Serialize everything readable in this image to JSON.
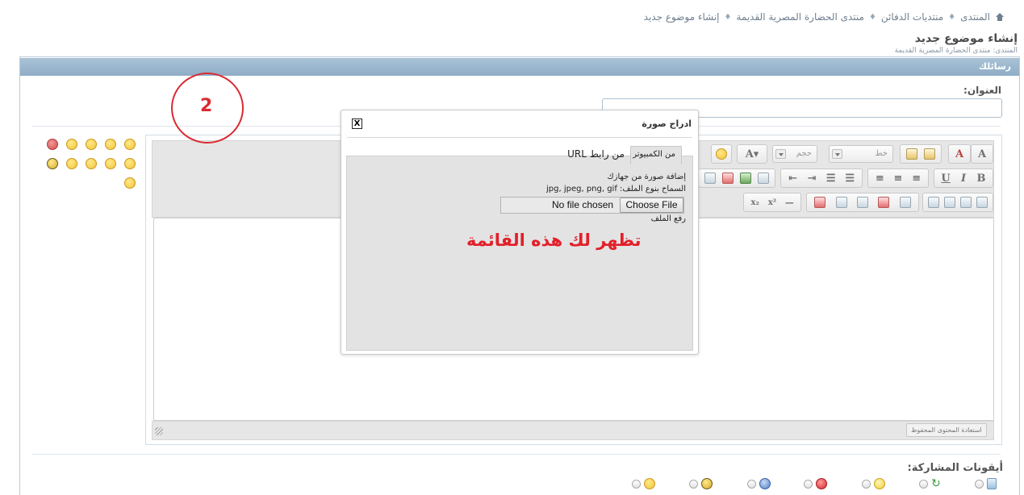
{
  "breadcrumb": {
    "items": [
      "المنتدى",
      "منتديات الدفائن",
      "منتدى الحضارة المصرية القديمة"
    ],
    "current": "إنشاء موضوع جديد",
    "separator": "♦"
  },
  "page": {
    "title": "إنشاء موضوع جديد",
    "subtitle": "المنتدى: منتدى الحضارة المصرية القديمة"
  },
  "section_header": "رسائلك",
  "form": {
    "title_label": "العنوان:",
    "title_value": ""
  },
  "editor": {
    "font_select": "خط",
    "size_select": "حجم",
    "restore_label": "استعادة المحتوى المحفوظ",
    "content": ""
  },
  "dialog": {
    "title": "ادراج صورة",
    "close_label": "X",
    "tabs": [
      "من الكمبيوتر",
      "من رابط URL"
    ],
    "active_tab": "من الكمبيوتر",
    "upload_heading": "إضافة صورة من جهازك",
    "allowed_types": "السماح بنوع الملف: jpg, jpeg, png, gif",
    "choose_button": "Choose File",
    "no_file": "No file chosen",
    "upload_label": "رفع الملف"
  },
  "annotation": {
    "text": "تظهر لك هذه القائمة",
    "number": "2",
    "color": "#e2202a"
  },
  "post_icons": {
    "label": "أيقونات المشاركة:"
  },
  "colors": {
    "header_bar": "#8fadc6",
    "accent_red": "#d92b32"
  }
}
